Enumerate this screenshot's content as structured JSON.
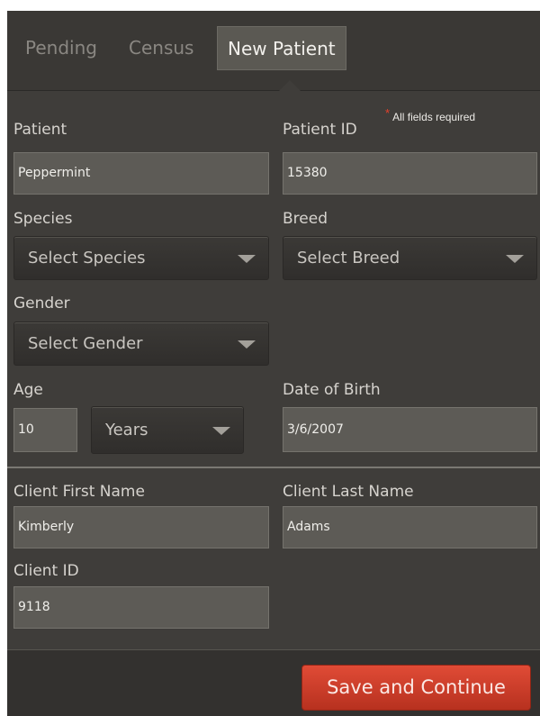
{
  "tabs": [
    "Pending",
    "Census",
    "New Patient"
  ],
  "required_note": "All fields required",
  "patient": {
    "label": "Patient",
    "value": "Peppermint"
  },
  "patient_id": {
    "label": "Patient ID",
    "value": "15380"
  },
  "species": {
    "label": "Species",
    "selected": "Select Species"
  },
  "breed": {
    "label": "Breed",
    "selected": "Select Breed"
  },
  "gender": {
    "label": "Gender",
    "selected": "Select Gender"
  },
  "age": {
    "label": "Age",
    "value": "10",
    "unit": "Years"
  },
  "dob": {
    "label": "Date of Birth",
    "value": "3/6/2007"
  },
  "client_first": {
    "label": "Client First Name",
    "value": "Kimberly"
  },
  "client_last": {
    "label": "Client Last Name",
    "value": "Adams"
  },
  "client_id": {
    "label": "Client ID",
    "value": "9118"
  },
  "save_button": "Save and Continue",
  "colors": {
    "accent": "#d9412c",
    "background": "#3f3d3a",
    "field": "#5d5b56"
  }
}
